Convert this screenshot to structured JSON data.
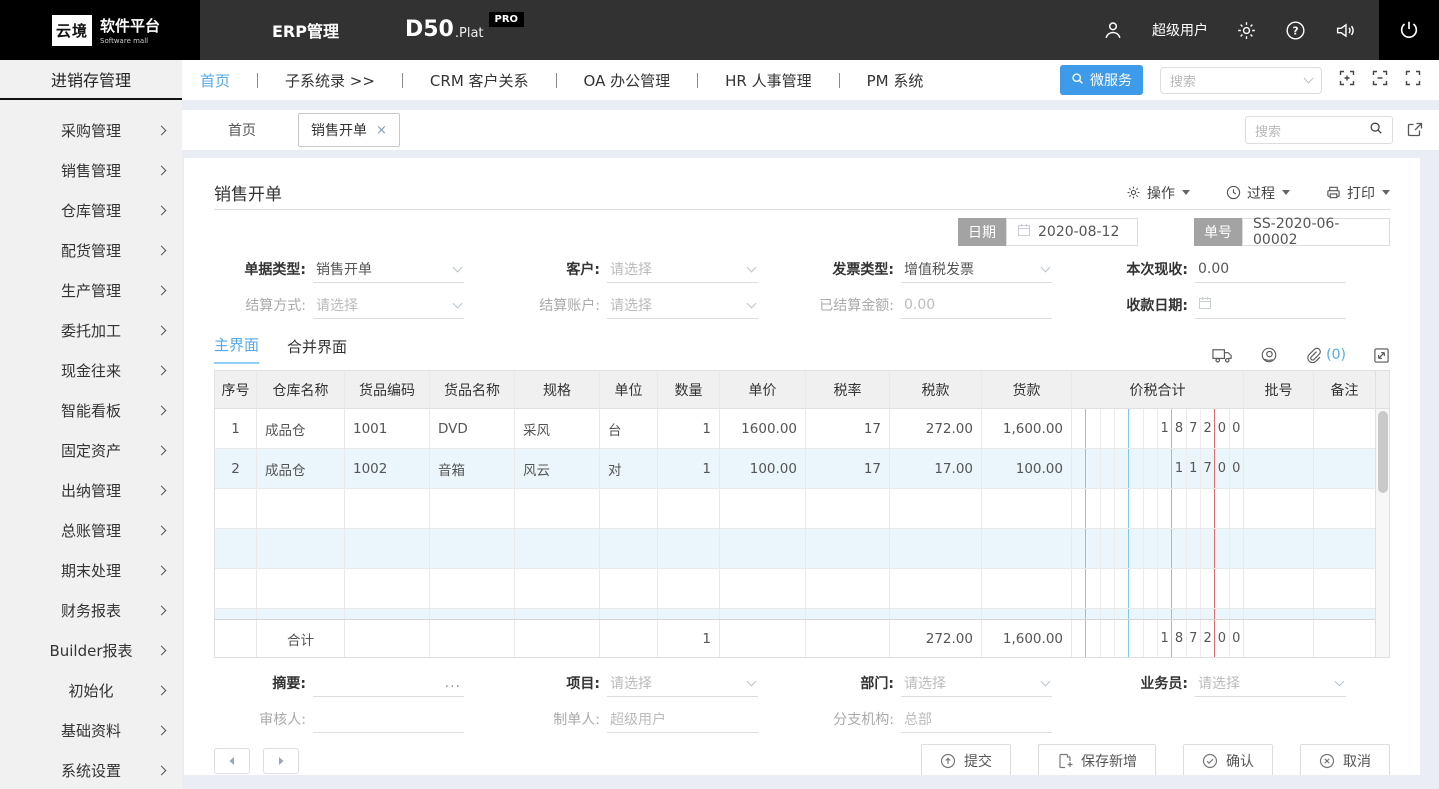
{
  "header": {
    "logo_mark": "云境",
    "logo_title": "软件平台",
    "logo_subtitle": "Software mall",
    "app_name": "ERP管理",
    "product_name": "D50",
    "product_suffix": ".Plat",
    "product_badge": "PRO",
    "username": "超级用户"
  },
  "topnav": {
    "module_title": "进销存管理",
    "links": [
      "首页",
      "子系统录 >>",
      "CRM 客户关系",
      "OA 办公管理",
      "HR 人事管理",
      "PM 系统"
    ],
    "microservice": "微服务",
    "search_placeholder": "搜索"
  },
  "sidebar": {
    "items": [
      "采购管理",
      "销售管理",
      "仓库管理",
      "配货管理",
      "生产管理",
      "委托加工",
      "现金往来",
      "智能看板",
      "固定资产",
      "出纳管理",
      "总账管理",
      "期末处理",
      "财务报表",
      "Builder报表",
      "初始化",
      "基础资料",
      "系统设置"
    ]
  },
  "tabbar": {
    "home": "首页",
    "active": "销售开单",
    "close": "×",
    "search_placeholder": "搜索"
  },
  "page": {
    "title": "销售开单",
    "actions": {
      "operate": "操作",
      "process": "过程",
      "print": "打印"
    },
    "doc": {
      "date_label": "日期",
      "date_value": "2020-08-12",
      "no_label": "单号",
      "no_value": "SS-2020-06-00002"
    },
    "form": {
      "doc_type_label": "单据类型:",
      "doc_type_value": "销售开单",
      "customer_label": "客户:",
      "customer_placeholder": "请选择",
      "invoice_label": "发票类型:",
      "invoice_value": "增值税发票",
      "cash_label": "本次现收:",
      "cash_value": "0.00",
      "settle_method_label": "结算方式:",
      "settle_method_placeholder": "请选择",
      "settle_account_label": "结算账户:",
      "settle_account_placeholder": "请选择",
      "settled_amount_label": "已结算金额:",
      "settled_amount_value": "0.00",
      "receipt_date_label": "收款日期:"
    },
    "sub_tabs": {
      "main": "主界面",
      "merged": "合并界面"
    },
    "attachment_count": "(0)"
  },
  "table": {
    "headers": [
      "序号",
      "仓库名称",
      "货品编码",
      "货品名称",
      "规格",
      "单位",
      "数量",
      "单价",
      "税率",
      "税款",
      "货款",
      "价税合计",
      "批号",
      "备注"
    ],
    "rows": [
      {
        "cells": [
          "1",
          "成品仓",
          "1001",
          "DVD",
          "采风",
          "台",
          "1",
          "1600.00",
          "17",
          "272.00",
          "1,600.00"
        ],
        "digits": [
          "",
          "",
          "",
          "",
          "",
          "",
          "1",
          "8",
          "7",
          "2",
          "0",
          "0"
        ]
      },
      {
        "cells": [
          "2",
          "成品仓",
          "1002",
          "音箱",
          "风云",
          "对",
          "1",
          "100.00",
          "17",
          "17.00",
          "100.00"
        ],
        "digits": [
          "",
          "",
          "",
          "",
          "",
          "",
          "",
          "1",
          "1",
          "7",
          "0",
          "0"
        ]
      }
    ],
    "empty_digits": [
      "",
      "",
      "",
      "",
      "",
      "",
      "",
      "",
      "",
      "",
      "",
      ""
    ],
    "total": {
      "label": "合计",
      "qty": "1",
      "tax": "272.00",
      "goods": "1,600.00",
      "digits": [
        "",
        "",
        "",
        "",
        "",
        "",
        "1",
        "8",
        "7",
        "2",
        "0",
        "0"
      ]
    }
  },
  "footer_form": {
    "summary_label": "摘要:",
    "summary_more": "...",
    "project_label": "项目:",
    "project_placeholder": "请选择",
    "dept_label": "部门:",
    "dept_placeholder": "请选择",
    "salesman_label": "业务员:",
    "salesman_placeholder": "请选择",
    "auditor_label": "审核人:",
    "creator_label": "制单人:",
    "creator_value": "超级用户",
    "branch_label": "分支机构:",
    "branch_value": "总部"
  },
  "buttons": {
    "submit": "提交",
    "save_new": "保存新增",
    "confirm": "确认",
    "cancel": "取消"
  },
  "colors": {
    "accent_blue": "#3d9bea",
    "link_blue": "#53a8e8",
    "alt_row": "#eaf5fc",
    "grid_blue_line": "#7ec8ee",
    "grid_red_line": "#e06c6c",
    "header_dark": "#323232",
    "header_black": "#000000"
  }
}
